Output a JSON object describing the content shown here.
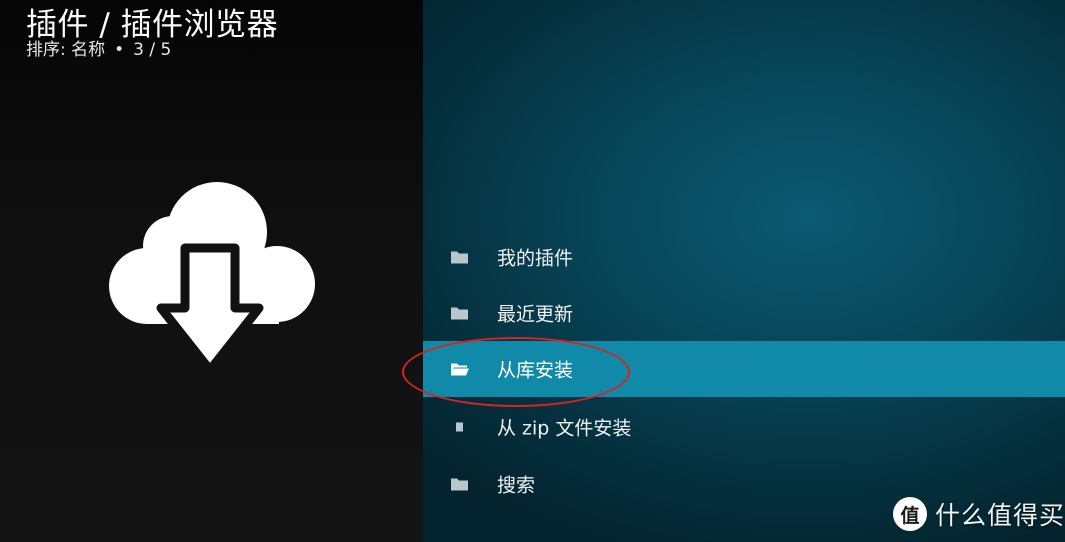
{
  "header": {
    "title": "插件 / 插件浏览器",
    "sort_label": "排序: 名称",
    "separator": "•",
    "position": "3 / 5"
  },
  "hero_icon": "cloud-download-icon",
  "menu": {
    "items": [
      {
        "label": "我的插件",
        "icon": "folder-icon",
        "selected": false
      },
      {
        "label": "最近更新",
        "icon": "folder-icon",
        "selected": false
      },
      {
        "label": "从库安装",
        "icon": "folder-open-icon",
        "selected": true
      },
      {
        "label": "从 zip 文件安装",
        "icon": "file-icon",
        "selected": false
      },
      {
        "label": "搜索",
        "icon": "folder-icon",
        "selected": false
      }
    ]
  },
  "watermark": {
    "logo_glyph": "值",
    "text": "什么值得买"
  },
  "colors": {
    "selected_bg": "#118aaa",
    "annotation_ring": "#d8231f",
    "left_panel": "#111111",
    "right_panel": "#074356"
  }
}
